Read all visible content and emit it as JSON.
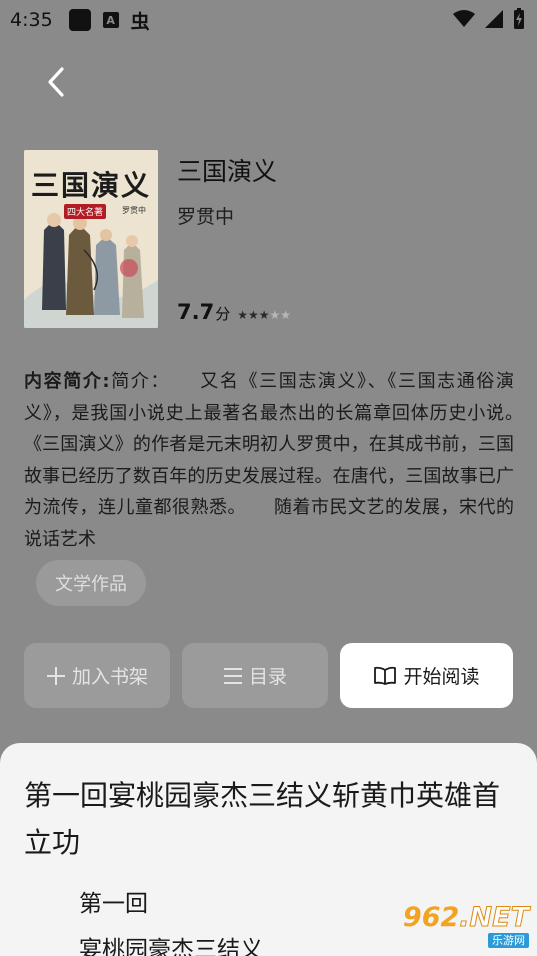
{
  "status_bar": {
    "time": "4:35",
    "icons": [
      "square-notification-icon",
      "a-notification-icon",
      "bug-notification-icon",
      "wifi-icon",
      "signal-icon",
      "battery-charging-icon"
    ],
    "bug_glyph": "虫",
    "a_glyph": "A"
  },
  "nav": {
    "back_icon": "chevron-left-icon"
  },
  "book": {
    "cover": {
      "title_art": "三国演义",
      "badge": "四大名著",
      "author_art": "罗贯中"
    },
    "title": "三国演义",
    "author": "罗贯中",
    "rating": "7.7",
    "rating_unit": "分",
    "stars_filled": 3,
    "stars_total": 5,
    "intro_label": "内容简介:",
    "intro_text": "简介：　　又名《三国志演义》、《三国志通俗演义》，是我国小说史上最著名最杰出的长篇章回体历史小说。　　《三国演义》的作者是元末明初人罗贯中，在其成书前，三国故事已经历了数百年的历史发展过程。在唐代，三国故事已广为流传，连儿童都很熟悉。　　随着市民文艺的发展，宋代的说话艺术",
    "tag": "文学作品"
  },
  "actions": {
    "add_shelf_label": "加入书架",
    "toc_label": "目录",
    "read_label": "开始阅读"
  },
  "chapter_sheet": {
    "title": "第一回宴桃园豪杰三结义斩黄巾英雄首立功",
    "lines": [
      "第一回",
      "宴桃园豪杰三结义"
    ]
  },
  "watermark": {
    "main": "962",
    "net": ".NET",
    "sub": "乐游网"
  },
  "colors": {
    "overlay": "#8a8a8a",
    "sheet": "#f4f4f4",
    "button_dim": "#9b9b9b",
    "watermark_orange": "#f2a322",
    "watermark_blue": "#2b9ad6"
  }
}
